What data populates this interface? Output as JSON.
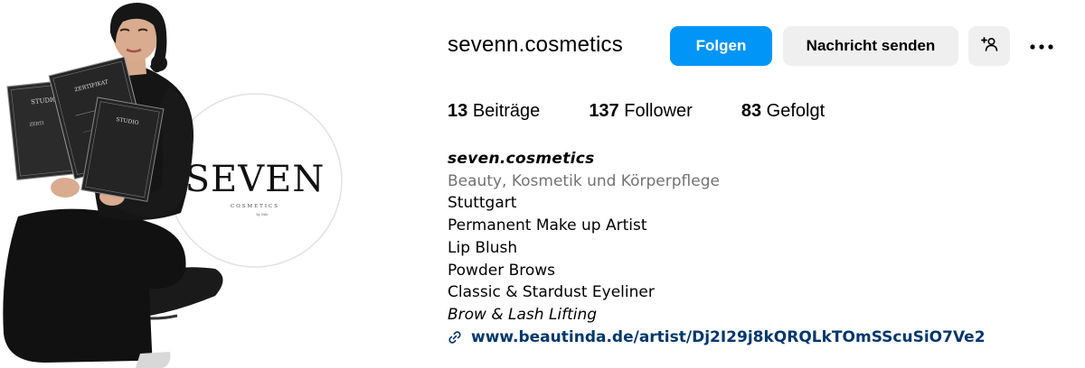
{
  "profile": {
    "username": "sevenn.cosmetics",
    "follow_label": "Folgen",
    "message_label": "Nachricht senden",
    "add_user_icon": "add-person-icon",
    "more_icon": "more-horizontal-icon"
  },
  "stats": [
    {
      "count": "13",
      "label": "Beiträge"
    },
    {
      "count": "137",
      "label": "Follower"
    },
    {
      "count": "83",
      "label": "Gefolgt"
    }
  ],
  "bio": {
    "full_name": "seven.cosmetics",
    "category": "Beauty, Kosmetik und Körperpflege",
    "lines": [
      "Stuttgart",
      "Permanent Make up Artist",
      "Lip Blush",
      "Powder Brows",
      "Classic & Stardust Eyeliner"
    ],
    "italic_line": "Brow & Lash Lifting",
    "link": "www.beautinda.de/artist/Dj2I29j8kQRQLkTOmSScuSiO7Ve2"
  },
  "logo": {
    "brand": "SEVEN",
    "sub": "COSMETICS",
    "tag": "by Nilu"
  },
  "certificates": [
    "STUDIO",
    "ZERTIFIKAT",
    "STUDIO"
  ],
  "colors": {
    "follow_button": "#0095f6",
    "secondary_button": "#efefef",
    "category_text": "#737373",
    "link_text": "#00376b"
  }
}
